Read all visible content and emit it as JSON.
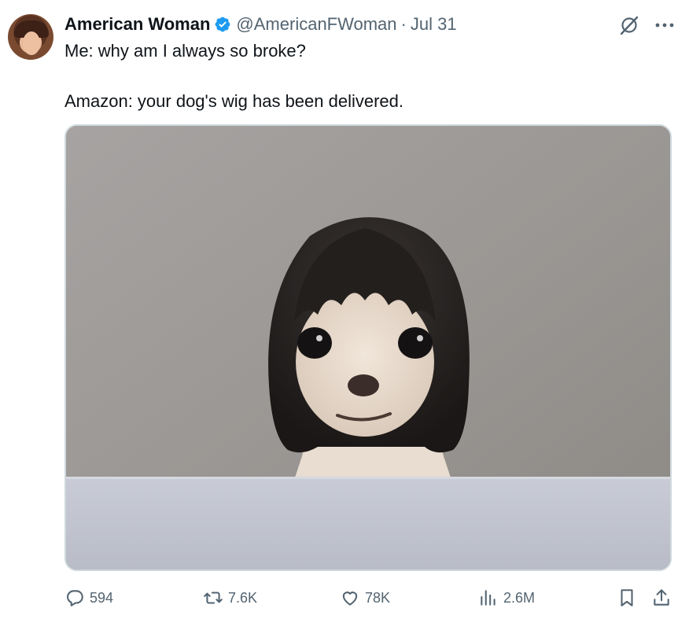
{
  "author": {
    "display_name": "American Woman",
    "handle": "@AmericanFWoman",
    "separator": "·",
    "date": "Jul 31",
    "verified": true
  },
  "tweet": {
    "line1": "Me: why am I always so broke?",
    "line2": "Amazon: your dog's wig has been delivered."
  },
  "stats": {
    "replies": "594",
    "retweets": "7.6K",
    "likes": "78K",
    "views": "2.6M"
  },
  "icons": {
    "verified": "verified-badge-icon",
    "grok": "grok-icon",
    "more": "more-icon",
    "reply": "reply-icon",
    "retweet": "retweet-icon",
    "like": "heart-icon",
    "views": "views-icon",
    "bookmark": "bookmark-icon",
    "share": "share-icon"
  },
  "colors": {
    "text": "#0f1419",
    "secondary": "#536471",
    "verified": "#1d9bf0",
    "border": "#cfd9de"
  }
}
